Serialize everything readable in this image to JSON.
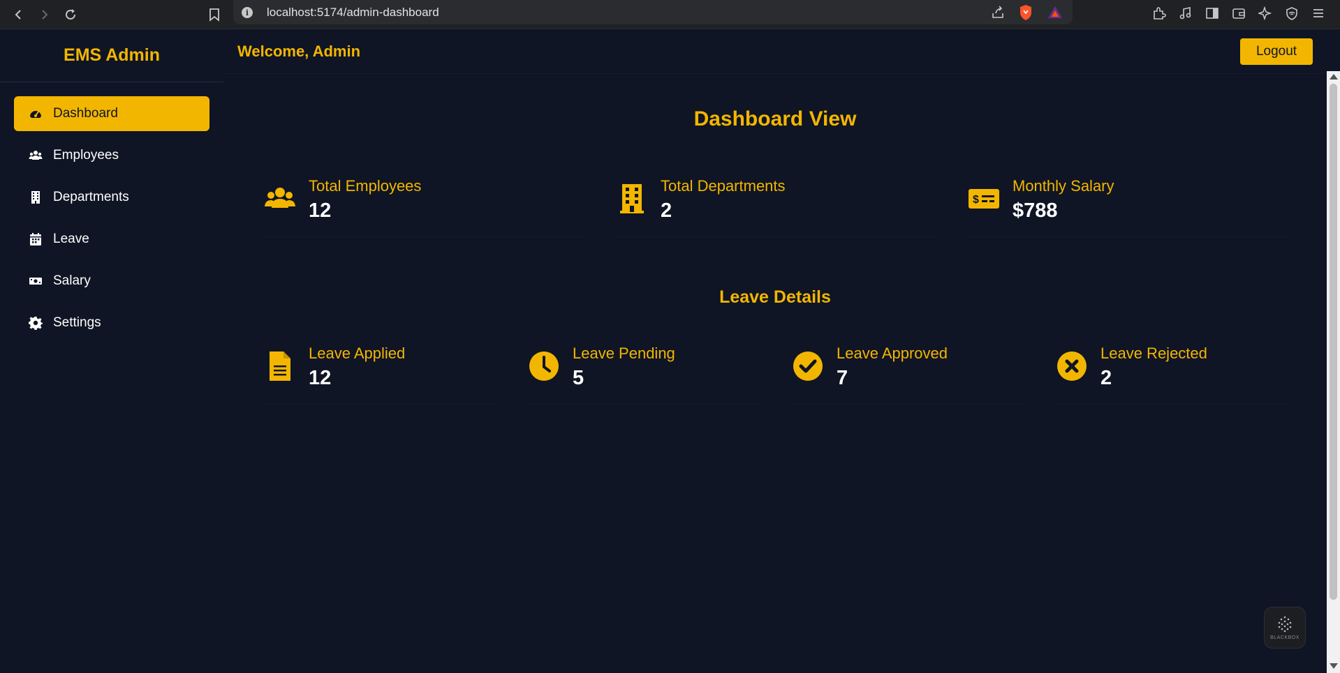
{
  "browser": {
    "url": "localhost:5174/admin-dashboard"
  },
  "app": {
    "brand": "EMS Admin",
    "welcome": "Welcome, Admin",
    "logout_label": "Logout"
  },
  "sidebar": {
    "items": [
      {
        "label": "Dashboard",
        "icon": "tachometer-icon",
        "active": true
      },
      {
        "label": "Employees",
        "icon": "users-icon",
        "active": false
      },
      {
        "label": "Departments",
        "icon": "building-icon",
        "active": false
      },
      {
        "label": "Leave",
        "icon": "calendar-icon",
        "active": false
      },
      {
        "label": "Salary",
        "icon": "money-bill-icon",
        "active": false
      },
      {
        "label": "Settings",
        "icon": "gear-icon",
        "active": false
      }
    ]
  },
  "dashboard": {
    "title": "Dashboard View",
    "summary": [
      {
        "label": "Total Employees",
        "value": "12",
        "icon": "users-icon"
      },
      {
        "label": "Total Departments",
        "value": "2",
        "icon": "building-icon"
      },
      {
        "label": "Monthly Salary",
        "value": "$788",
        "icon": "money-check-icon"
      }
    ],
    "leave_title": "Leave Details",
    "leave": [
      {
        "label": "Leave Applied",
        "value": "12",
        "icon": "file-text-icon"
      },
      {
        "label": "Leave Pending",
        "value": "5",
        "icon": "clock-icon"
      },
      {
        "label": "Leave Approved",
        "value": "7",
        "icon": "check-circle-icon"
      },
      {
        "label": "Leave Rejected",
        "value": "2",
        "icon": "times-circle-icon"
      }
    ]
  },
  "widget": {
    "label": "BLACKBOX"
  },
  "colors": {
    "accent": "#f3b600",
    "background": "#0f1524",
    "text": "#ffffff"
  }
}
